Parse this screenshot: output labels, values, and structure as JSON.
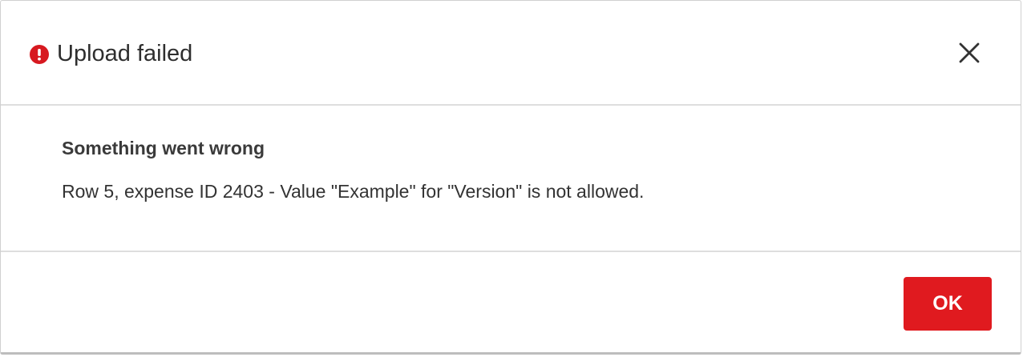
{
  "dialog": {
    "title": "Upload failed",
    "error_heading": "Something went wrong",
    "error_message": "Row 5, expense ID 2403 - Value \"Example\" for \"Version\" is not allowed.",
    "ok_label": "OK",
    "icons": {
      "status": "error-icon",
      "close": "close-icon"
    },
    "colors": {
      "accent": "#e01a1f",
      "error_icon": "#d71920",
      "text": "#2e2e2e"
    }
  }
}
